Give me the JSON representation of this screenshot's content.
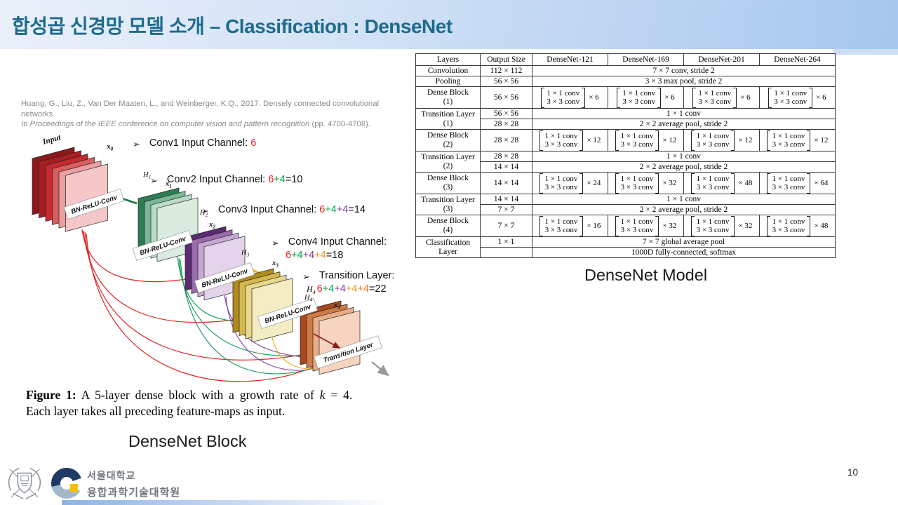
{
  "slide": {
    "title": "합성곱 신경망 모델 소개 – Classification : DenseNet",
    "page_number": "10"
  },
  "citation": {
    "line1": "Huang, G., Liu, Z., Van Der Maaten, L., and Weinberger, K.Q., 2017. Densely connected convolutional networks.",
    "line2_prefix": "In ",
    "line2_italic": "Proceedings of the IEEE conference on computer vision and pattern recognition",
    "line2_suffix": " (pp. 4700-4708)."
  },
  "figure": {
    "diagram": {
      "input_label": "Input",
      "bn_label": "BN-ReLU-Conv",
      "transition_label": "Transition Layer",
      "x0": {
        "base": "x",
        "sub": "0"
      },
      "x1": {
        "base": "x",
        "sub": "1"
      },
      "x2": {
        "base": "x",
        "sub": "2"
      },
      "x3": {
        "base": "x",
        "sub": "3"
      },
      "x4": {
        "base": "x",
        "sub": "4"
      },
      "h1": {
        "base": "H",
        "sub": "1"
      },
      "h2": {
        "base": "H",
        "sub": "2"
      },
      "h3": {
        "base": "H",
        "sub": "3"
      },
      "h4": {
        "base": "H",
        "sub": "4"
      }
    },
    "bullets": {
      "b1": {
        "marker": "➢",
        "label": "Conv1 Input Channel: ",
        "red": "6"
      },
      "b2": {
        "marker": "➢",
        "label": "Conv2 Input Channel: ",
        "red": "6",
        "green": "+4",
        "rest": "=10"
      },
      "b3": {
        "marker": "➢",
        "label": "Conv3 Input Channel: ",
        "red": "6",
        "green": "+4",
        "purple": "+4",
        "rest": "=14"
      },
      "b4": {
        "marker": "➢",
        "label": "Conv4 Input Channel:",
        "red": "6",
        "green": "+4",
        "purple": "+4",
        "gold": "+4",
        "rest": "=18"
      },
      "b5": {
        "marker": "➢",
        "label": "Transition Layer:",
        "h_base": "H",
        "h_sub": "4",
        "red": "6",
        "green": "+4",
        "purple": "+4",
        "gold": "+4",
        "orange": "+4",
        "rest": "=22"
      }
    },
    "caption": {
      "label": "Figure 1:",
      "body_pre": " A 5-layer dense block with a growth rate of ",
      "k": "k",
      "body_post": " = 4.",
      "line2": "Each layer takes all preceding feature-maps as input."
    },
    "block_label": "DenseNet Block"
  },
  "table": {
    "headers": [
      "Layers",
      "Output Size",
      "DenseNet-121",
      "DenseNet-169",
      "DenseNet-201",
      "DenseNet-264"
    ],
    "convolution": {
      "layer": "Convolution",
      "output": "112 × 112",
      "op": "7 × 7 conv, stride 2"
    },
    "pooling": {
      "layer": "Pooling",
      "output": "56 × 56",
      "op": "3 × 3 max pool, stride 2"
    },
    "dense_blocks": [
      {
        "layer": "Dense Block",
        "sub": "(1)",
        "output": "56 × 56",
        "conv1": "1 × 1 conv",
        "conv2": "3 × 3 conv",
        "mults": [
          "× 6",
          "× 6",
          "× 6",
          "× 6"
        ]
      },
      {
        "layer": "Dense Block",
        "sub": "(2)",
        "output": "28 × 28",
        "conv1": "1 × 1 conv",
        "conv2": "3 × 3 conv",
        "mults": [
          "× 12",
          "× 12",
          "× 12",
          "× 12"
        ]
      },
      {
        "layer": "Dense Block",
        "sub": "(3)",
        "output": "14 × 14",
        "conv1": "1 × 1 conv",
        "conv2": "3 × 3 conv",
        "mults": [
          "× 24",
          "× 32",
          "× 48",
          "× 64"
        ]
      },
      {
        "layer": "Dense Block",
        "sub": "(4)",
        "output": "7 × 7",
        "conv1": "1 × 1 conv",
        "conv2": "3 × 3 conv",
        "mults": [
          "× 16",
          "× 32",
          "× 32",
          "× 48"
        ]
      }
    ],
    "transition_layers": [
      {
        "layer": "Transition Layer",
        "sub": "(1)",
        "output_a": "56 × 56",
        "op_a": "1 × 1 conv",
        "output_b": "28 × 28",
        "op_b": "2 × 2 average pool, stride 2"
      },
      {
        "layer": "Transition Layer",
        "sub": "(2)",
        "output_a": "28 × 28",
        "op_a": "1 × 1 conv",
        "output_b": "14 × 14",
        "op_b": "2 × 2 average pool, stride 2"
      },
      {
        "layer": "Transition Layer",
        "sub": "(3)",
        "output_a": "14 × 14",
        "op_a": "1 × 1 conv",
        "output_b": "7 × 7",
        "op_b": "2 × 2 average pool, stride 2"
      }
    ],
    "classification": {
      "layer_line1": "Classification",
      "layer_line2": "Layer",
      "output": "1 × 1",
      "op_a": "7 × 7 global average pool",
      "op_b": "1000D fully-connected, softmax"
    }
  },
  "model_label": "DenseNet Model",
  "footer": {
    "university": "서울대학교",
    "department": "융합과학기술대학원"
  },
  "colors": {
    "title_teal": "#1e6b8c",
    "channel_red": "#ed1c24",
    "channel_green": "#00a551",
    "channel_purple": "#7d3f98",
    "channel_gold": "#f09b1d",
    "channel_orange": "#ef7d23",
    "header_gradient_start": "#eaf0fa",
    "header_gradient_end": "#a6c7ee"
  }
}
